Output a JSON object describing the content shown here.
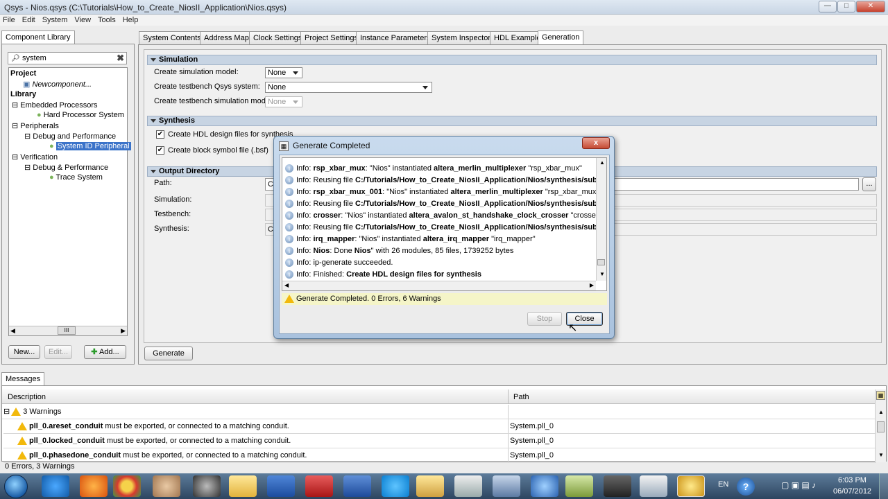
{
  "window": {
    "title": "Qsys - Nios.qsys (C:\\Tutorials\\How_to_Create_NiosII_Application\\Nios.qsys)",
    "min": "—",
    "max": "□",
    "close": "✕"
  },
  "menu": [
    "File",
    "Edit",
    "System",
    "View",
    "Tools",
    "Help"
  ],
  "left": {
    "tab": "Component Library",
    "search": "system",
    "new": "New...",
    "edit": "Edit...",
    "add": "Add...",
    "scroll": "III"
  },
  "tree": {
    "project": "Project",
    "newcomp": "Newcomponent...",
    "library": "Library",
    "embedded": "Embedded Processors",
    "hps": "Hard Processor System",
    "peripherals": "Peripherals",
    "debugperf": "Debug and Performance",
    "sysid": "System ID Peripheral",
    "verification": "Verification",
    "debugperf2": "Debug & Performance",
    "trace": "Trace System"
  },
  "tabs": [
    "System Contents",
    "Address Map",
    "Clock Settings",
    "Project Settings",
    "Instance Parameters",
    "System Inspector",
    "HDL Example",
    "Generation"
  ],
  "simulation": {
    "header": "Simulation",
    "sim_model_label": "Create simulation model:",
    "sim_model": "None",
    "tb_label": "Create testbench Qsys system:",
    "tb": "None",
    "tb_sim_label": "Create testbench simulation model:",
    "tb_sim": "None"
  },
  "synthesis": {
    "header": "Synthesis",
    "hdl": "Create HDL design files for synthesis",
    "bsf": "Create block symbol file (.bsf)"
  },
  "output": {
    "header": "Output Directory",
    "path": "Path:",
    "simulation": "Simulation:",
    "testbench": "Testbench:",
    "synthesis": "Synthesis:",
    "c1": "C",
    "c2": "C",
    "browse": "..."
  },
  "generate": "Generate",
  "dialog": {
    "title": "Generate Completed",
    "close_x": "x",
    "status": "Generate Completed. 0 Errors, 6 Warnings",
    "stop": "Stop",
    "close": "Close",
    "rows": [
      {
        "pre": "Info: ",
        "b1": "rsp_xbar_mux",
        "m1": ": \"Nios\" instantiated ",
        "b2": "altera_merlin_multiplexer",
        "m2": " \"rsp_xbar_mux\""
      },
      {
        "pre": "Info: ",
        "b1": "",
        "m1": "Reusing file ",
        "b2": "C:/Tutorials/How_to_Create_NiosII_Application/Nios/synthesis/submo",
        "m2": ""
      },
      {
        "pre": "Info: ",
        "b1": "rsp_xbar_mux_001",
        "m1": ": \"Nios\" instantiated ",
        "b2": "altera_merlin_multiplexer",
        "m2": " \"rsp_xbar_mux_"
      },
      {
        "pre": "Info: ",
        "b1": "",
        "m1": "Reusing file ",
        "b2": "C:/Tutorials/How_to_Create_NiosII_Application/Nios/synthesis/submo",
        "m2": ""
      },
      {
        "pre": "Info: ",
        "b1": "crosser",
        "m1": ": \"Nios\" instantiated ",
        "b2": "altera_avalon_st_handshake_clock_crosser",
        "m2": " \"crosser"
      },
      {
        "pre": "Info: ",
        "b1": "",
        "m1": "Reusing file ",
        "b2": "C:/Tutorials/How_to_Create_NiosII_Application/Nios/synthesis/submo",
        "m2": ""
      },
      {
        "pre": "Info: ",
        "b1": "irq_mapper",
        "m1": ": \"Nios\" instantiated ",
        "b2": "altera_irq_mapper",
        "m2": " \"irq_mapper\""
      },
      {
        "pre": "Info: ",
        "b1": "Nios",
        "m1": ": Done ",
        "b2": "Nios",
        "m2": "\" with 26 modules, 85 files, 1739252 bytes"
      },
      {
        "pre": "Info: ",
        "b1": "",
        "m1": "ip-generate succeeded.",
        "b2": "",
        "m2": ""
      },
      {
        "pre": "Info: ",
        "b1": "",
        "m1": "Finished: ",
        "b2": "Create HDL design files for synthesis",
        "m2": ""
      }
    ]
  },
  "messages": {
    "tab": "Messages",
    "col_desc": "Description",
    "col_path": "Path",
    "group": "3 Warnings",
    "rows": [
      {
        "b": "pll_0.areset_conduit",
        "t": " must be exported, or connected to a matching conduit.",
        "path": "System.pll_0"
      },
      {
        "b": "pll_0.locked_conduit",
        "t": " must be exported, or connected to a matching conduit.",
        "path": "System.pll_0"
      },
      {
        "b": "pll_0.phasedone_conduit",
        "t": " must be exported, or connected to a matching conduit.",
        "path": "System.pll_0"
      }
    ],
    "status": "0 Errors, 3 Warnings"
  },
  "taskbar": {
    "lang": "EN",
    "time": "6:03 PM",
    "date": "06/07/2012"
  }
}
